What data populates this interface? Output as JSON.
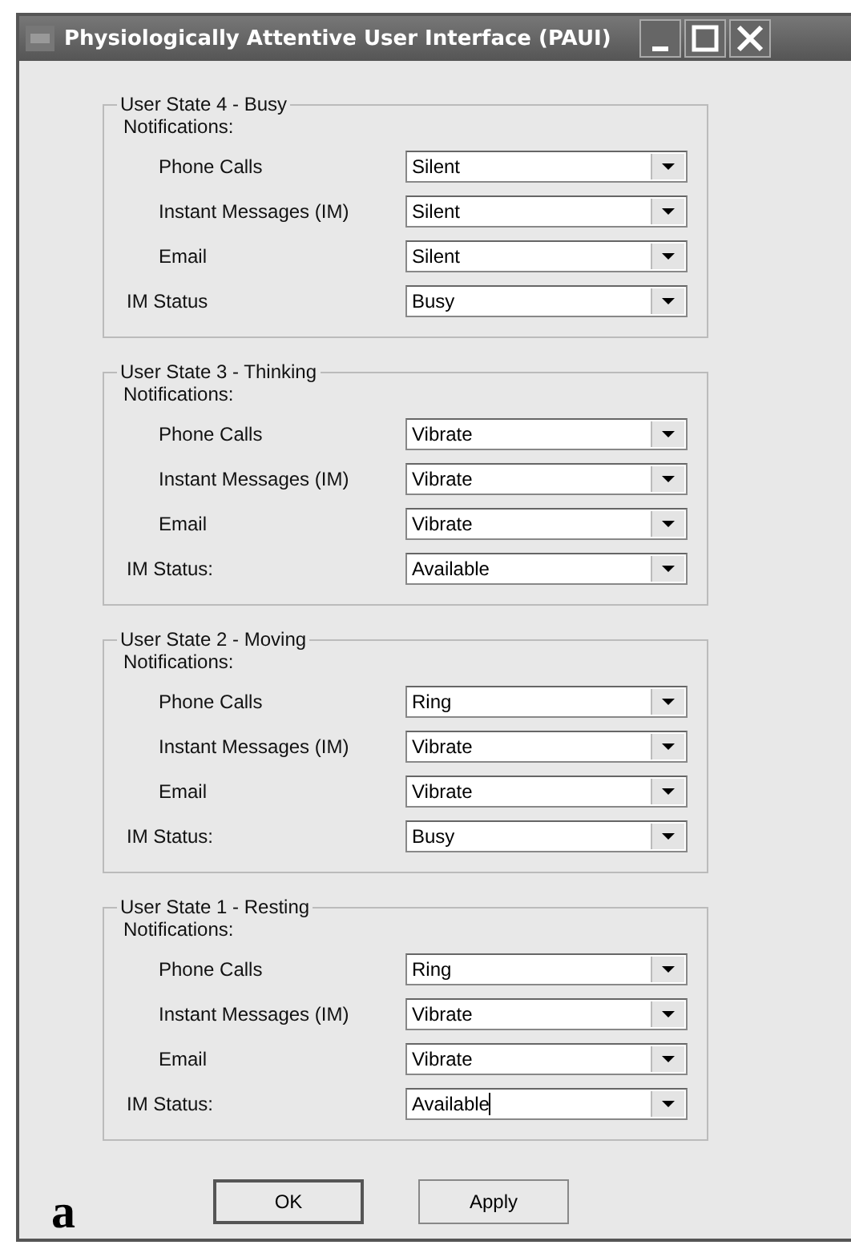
{
  "window": {
    "title": "Physiologically Attentive User Interface (PAUI)"
  },
  "groups": [
    {
      "legend": "User State 4 - Busy",
      "notifications_label": "Notifications:",
      "rows": [
        {
          "kind": "notification",
          "label": "Phone Calls",
          "value": "Silent"
        },
        {
          "kind": "notification",
          "label": "Instant Messages (IM)",
          "value": "Silent"
        },
        {
          "kind": "notification",
          "label": "Email",
          "value": "Silent"
        },
        {
          "kind": "status",
          "label": "IM Status",
          "value": "Busy"
        }
      ]
    },
    {
      "legend": "User State 3 - Thinking",
      "notifications_label": "Notifications:",
      "rows": [
        {
          "kind": "notification",
          "label": "Phone Calls",
          "value": "Vibrate"
        },
        {
          "kind": "notification",
          "label": "Instant Messages (IM)",
          "value": "Vibrate"
        },
        {
          "kind": "notification",
          "label": "Email",
          "value": "Vibrate"
        },
        {
          "kind": "status",
          "label": "IM Status:",
          "value": "Available"
        }
      ]
    },
    {
      "legend": "User State 2 - Moving",
      "notifications_label": "Notifications:",
      "rows": [
        {
          "kind": "notification",
          "label": "Phone Calls",
          "value": "Ring"
        },
        {
          "kind": "notification",
          "label": "Instant Messages (IM)",
          "value": "Vibrate"
        },
        {
          "kind": "notification",
          "label": "Email",
          "value": "Vibrate"
        },
        {
          "kind": "status",
          "label": "IM Status:",
          "value": "Busy"
        }
      ]
    },
    {
      "legend": "User State 1 - Resting",
      "notifications_label": "Notifications:",
      "rows": [
        {
          "kind": "notification",
          "label": "Phone Calls",
          "value": "Ring"
        },
        {
          "kind": "notification",
          "label": "Instant Messages (IM)",
          "value": "Vibrate"
        },
        {
          "kind": "notification",
          "label": "Email",
          "value": "Vibrate"
        },
        {
          "kind": "status",
          "label": "IM Status:",
          "value": "Available",
          "focused": true
        }
      ]
    }
  ],
  "buttons": [
    {
      "label": "OK",
      "default": true
    },
    {
      "label": "Apply",
      "default": false
    }
  ],
  "figure_label": "a"
}
